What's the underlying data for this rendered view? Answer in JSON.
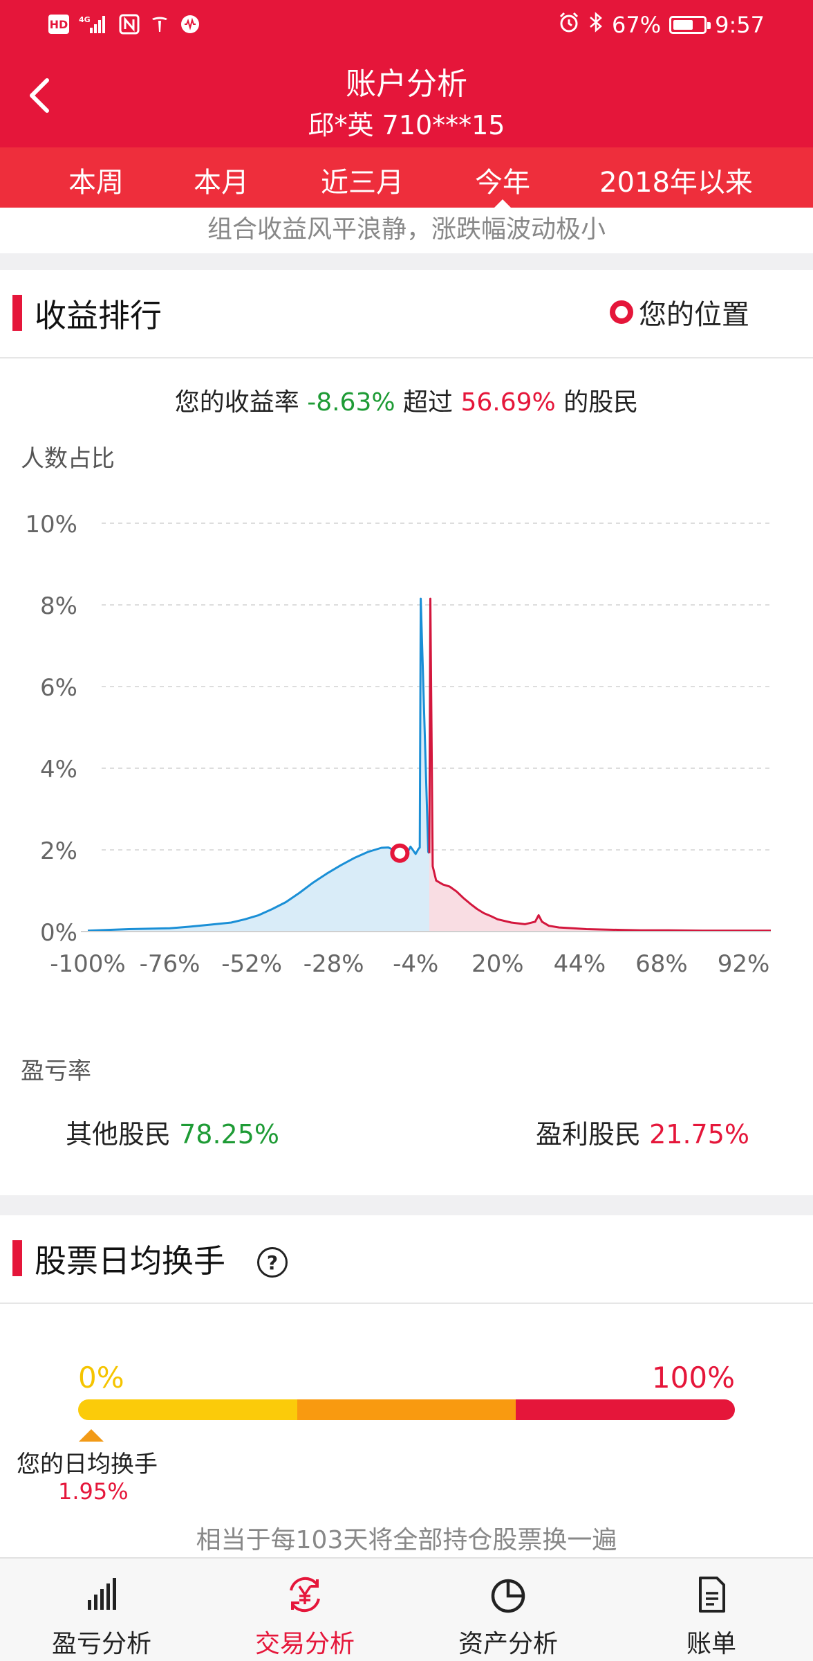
{
  "status_bar": {
    "left_icons": [
      "hd-icon",
      "signal-4g-icon",
      "nfc-icon",
      "tesla-icon",
      "audio-icon"
    ],
    "hd": "HD",
    "battery_percent": "67%",
    "battery_level": 0.67,
    "time": "9:57"
  },
  "header": {
    "title": "账户分析",
    "account": "邱*英 710***15"
  },
  "tabs": [
    {
      "label": "本周",
      "active": false
    },
    {
      "label": "本月",
      "active": false
    },
    {
      "label": "近三月",
      "active": false
    },
    {
      "label": "今年",
      "active": true
    },
    {
      "label": "2018年以来",
      "active": false
    }
  ],
  "description": "组合收益风平浪静，涨跌幅波动极小",
  "ranking": {
    "title": "收益排行",
    "legend_label": "您的位置",
    "summary_prefix": "您的收益率",
    "summary_rate": "-8.63%",
    "summary_mid": "超过",
    "summary_pct": "56.69%",
    "summary_suffix": "的股民",
    "y_axis_title": "人数占比",
    "x_axis_title": "盈亏率",
    "others_label": "其他股民",
    "others_value": "78.25%",
    "profit_label": "盈利股民",
    "profit_value": "21.75%"
  },
  "chart_data": {
    "type": "area",
    "ylabel": "人数占比",
    "xlabel": "盈亏率",
    "ylim": [
      0,
      10
    ],
    "xlim": [
      -100,
      100
    ],
    "yticks": [
      "0%",
      "2%",
      "4%",
      "6%",
      "8%",
      "10%"
    ],
    "yticks_values": [
      0,
      2,
      4,
      6,
      8,
      10
    ],
    "xticks": [
      "-100%",
      "-76%",
      "-52%",
      "-28%",
      "-4%",
      "20%",
      "44%",
      "68%",
      "92%"
    ],
    "xticks_values": [
      -100,
      -76,
      -52,
      -28,
      -4,
      20,
      44,
      68,
      92
    ],
    "grid": true,
    "marker": {
      "x": -8.63,
      "y": 1.92,
      "label": "您的位置"
    },
    "series": [
      {
        "color": "#1a8fd6",
        "fill": "#d9ecf8",
        "x": [
          -100,
          -94,
          -88,
          -82,
          -76,
          -70,
          -64,
          -58,
          -54,
          -50,
          -46,
          -42,
          -38,
          -34,
          -30,
          -26,
          -22,
          -18,
          -14,
          -12,
          -10,
          -9,
          -8,
          -7,
          -6,
          -5.5,
          -4,
          -3.2,
          -2.8,
          -2.5,
          -0.3,
          0
        ],
        "y": [
          0.02,
          0.04,
          0.06,
          0.07,
          0.08,
          0.12,
          0.17,
          0.22,
          0.3,
          0.4,
          0.55,
          0.72,
          0.95,
          1.2,
          1.42,
          1.62,
          1.8,
          1.95,
          2.05,
          2.06,
          1.98,
          2.02,
          1.92,
          1.88,
          2.0,
          2.08,
          1.9,
          2.02,
          2.06,
          8.15,
          1.95,
          1.92
        ]
      },
      {
        "color": "#d3173d",
        "fill": "#f9dde3",
        "x": [
          0,
          0.3,
          1,
          2,
          4,
          6,
          8,
          10,
          12,
          14,
          16,
          18,
          20,
          24,
          28,
          31,
          32,
          33,
          35,
          38,
          42,
          46,
          50,
          56,
          62,
          70,
          80,
          90,
          100
        ],
        "y": [
          1.92,
          8.15,
          1.6,
          1.25,
          1.15,
          1.1,
          0.98,
          0.82,
          0.68,
          0.55,
          0.45,
          0.38,
          0.3,
          0.22,
          0.18,
          0.24,
          0.4,
          0.24,
          0.14,
          0.1,
          0.08,
          0.06,
          0.05,
          0.04,
          0.03,
          0.03,
          0.02,
          0.02,
          0.02
        ]
      }
    ]
  },
  "turnover": {
    "title": "股票日均换手",
    "help_icon": "?",
    "left_pct": "0%",
    "right_pct": "100%",
    "segment_colors": [
      "#fbcb0a",
      "#f99a10",
      "#e5163a"
    ],
    "marker_label": "您的日均换手",
    "marker_value": "1.95%",
    "marker_fraction": 0.0195,
    "note": "相当于每103天将全部持仓股票换一遍"
  },
  "bottom_nav": [
    {
      "label": "盈亏分析",
      "icon": "bar-chart-icon",
      "active": false
    },
    {
      "label": "交易分析",
      "icon": "yen-exchange-icon",
      "active": true
    },
    {
      "label": "资产分析",
      "icon": "pie-chart-icon",
      "active": false
    },
    {
      "label": "账单",
      "icon": "document-icon",
      "active": false
    }
  ]
}
